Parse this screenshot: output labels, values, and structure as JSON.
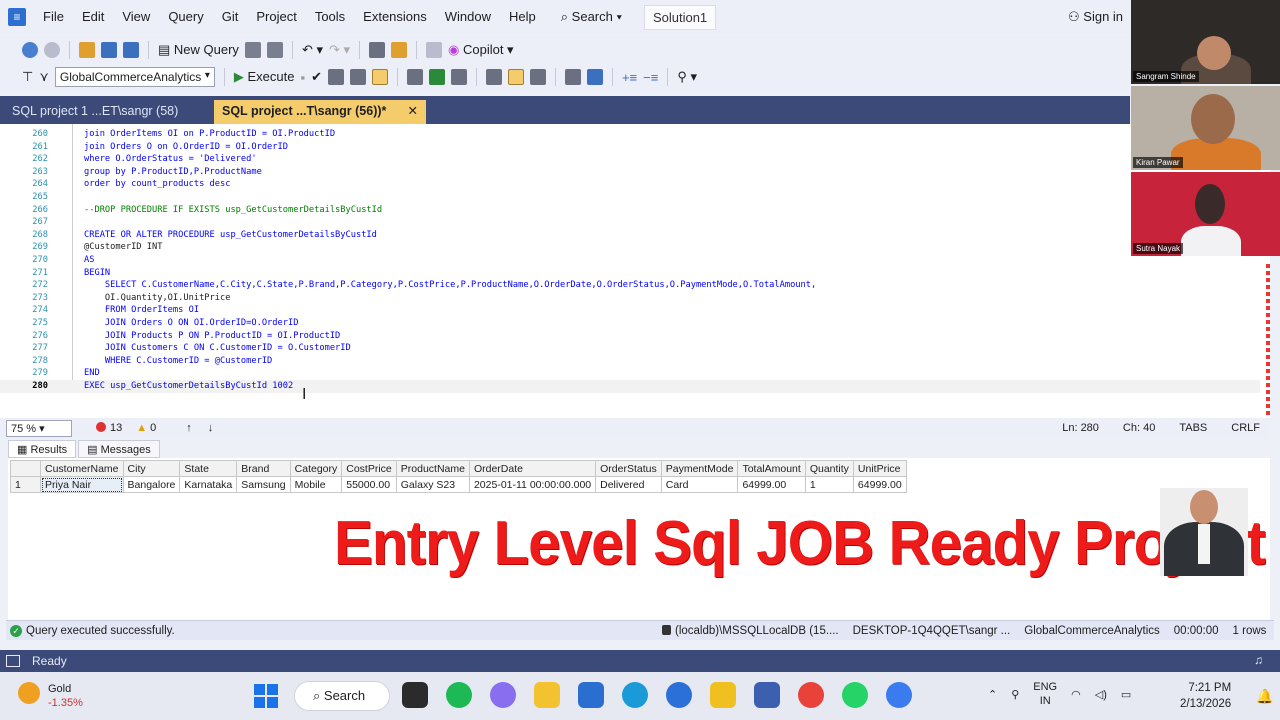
{
  "menu": {
    "items": [
      "File",
      "Edit",
      "View",
      "Query",
      "Git",
      "Project",
      "Tools",
      "Extensions",
      "Window",
      "Help"
    ],
    "search": "Search",
    "solution": "Solution1",
    "signin": "Sign in"
  },
  "toolbar": {
    "new_query": "New Query",
    "copilot": "Copilot",
    "database": "GlobalCommerceAnalytics",
    "execute": "Execute"
  },
  "tabs": {
    "inactive": "SQL project 1 ...ET\\sangr (58)",
    "active": "SQL project ...T\\sangr (56))*",
    "active_close": "✕"
  },
  "code": {
    "lines": [
      {
        "n": "260",
        "t": "join OrderItems OI on P.ProductID = OI.ProductID"
      },
      {
        "n": "261",
        "t": "join Orders O on O.OrderID = OI.OrderID"
      },
      {
        "n": "262",
        "t": "where O.OrderStatus = 'Delivered'"
      },
      {
        "n": "263",
        "t": "group by P.ProductID,P.ProductName"
      },
      {
        "n": "264",
        "t": "order by count_products desc"
      },
      {
        "n": "265",
        "t": ""
      },
      {
        "n": "266",
        "t": "--DROP PROCEDURE IF EXISTS usp_GetCustomerDetailsByCustId"
      },
      {
        "n": "267",
        "t": ""
      },
      {
        "n": "268",
        "t": "CREATE OR ALTER PROCEDURE usp_GetCustomerDetailsByCustId"
      },
      {
        "n": "269",
        "t": "@CustomerID INT"
      },
      {
        "n": "270",
        "t": "AS"
      },
      {
        "n": "271",
        "t": "BEGIN"
      },
      {
        "n": "272",
        "t": "    SELECT C.CustomerName,C.City,C.State,P.Brand,P.Category,P.CostPrice,P.ProductName,O.OrderDate,O.OrderStatus,O.PaymentMode,O.TotalAmount,"
      },
      {
        "n": "273",
        "t": "    OI.Quantity,OI.UnitPrice"
      },
      {
        "n": "274",
        "t": "    FROM OrderItems OI"
      },
      {
        "n": "275",
        "t": "    JOIN Orders O ON OI.OrderID=O.OrderID"
      },
      {
        "n": "276",
        "t": "    JOIN Products P ON P.ProductID = OI.ProductID"
      },
      {
        "n": "277",
        "t": "    JOIN Customers C ON C.CustomerID = O.CustomerID"
      },
      {
        "n": "278",
        "t": "    WHERE C.CustomerID = @CustomerID"
      },
      {
        "n": "279",
        "t": "END"
      },
      {
        "n": "280",
        "t": "EXEC usp_GetCustomerDetailsByCustId 1002"
      }
    ]
  },
  "editor_status": {
    "zoom": "75 %",
    "errors": "13",
    "warnings": "0",
    "ln": "Ln: 280",
    "ch": "Ch: 40",
    "tabs": "TABS",
    "crlf": "CRLF"
  },
  "results": {
    "tab_results": "Results",
    "tab_messages": "Messages",
    "columns": [
      "CustomerName",
      "City",
      "State",
      "Brand",
      "Category",
      "CostPrice",
      "ProductName",
      "OrderDate",
      "OrderStatus",
      "PaymentMode",
      "TotalAmount",
      "Quantity",
      "UnitPrice"
    ],
    "rows": [
      {
        "num": "1",
        "cells": [
          "Priya Nair",
          "Bangalore",
          "Karnataka",
          "Samsung",
          "Mobile",
          "55000.00",
          "Galaxy S23",
          "2025-01-11 00:00:00.000",
          "Delivered",
          "Card",
          "64999.00",
          "1",
          "64999.00"
        ]
      }
    ]
  },
  "overlay_title": "Entry Level Sql JOB Ready Project",
  "query_status": {
    "message": "Query executed successfully.",
    "server": "(localdb)\\MSSQLLocalDB (15....",
    "user": "DESKTOP-1Q4QQET\\sangr ...",
    "database": "GlobalCommerceAnalytics",
    "time": "00:00:00",
    "rows": "1 rows"
  },
  "app_status": "Ready",
  "participants": [
    "Sangram Shinde",
    "Kiran Pawar",
    "Sutra Nayak"
  ],
  "taskbar": {
    "weather_label": "Gold",
    "weather_change": "-1.35%",
    "search": "Search",
    "lang1": "ENG",
    "lang2": "IN",
    "time": "7:21 PM",
    "date": "2/13/2026"
  },
  "colors": {
    "accent": "#3b4a79",
    "active_tab": "#f5cc6b",
    "overlay_red": "#ee1b1b"
  }
}
